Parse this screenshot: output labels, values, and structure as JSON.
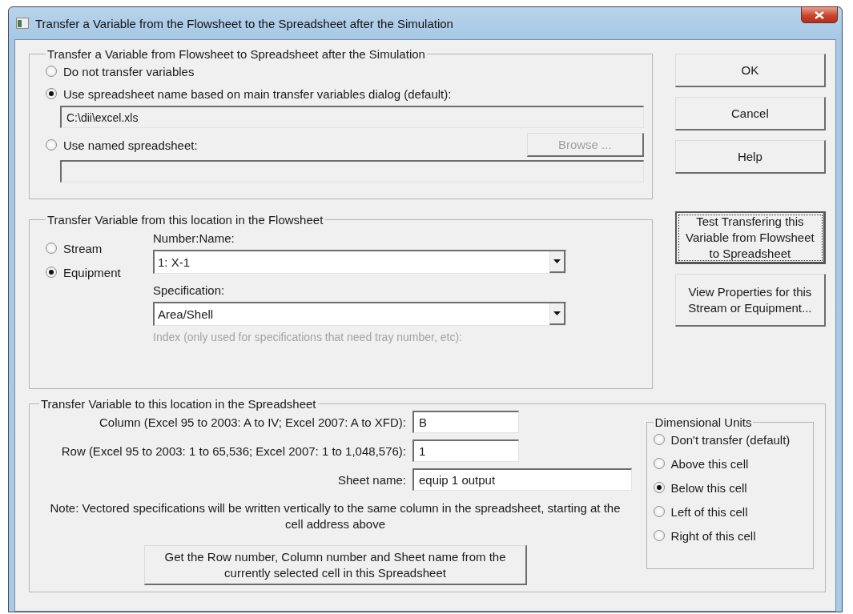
{
  "window": {
    "title": "Transfer a Variable from the Flowsheet to the Spreadsheet after the Simulation"
  },
  "transfer_group": {
    "title": "Transfer a Variable from Flowsheet to Spreadsheet after the Simulation",
    "options": [
      {
        "label": "Do not transfer variables",
        "selected": false
      },
      {
        "label": "Use spreadsheet name based on main transfer variables dialog (default):",
        "selected": true,
        "field": {
          "value": "C:\\dii\\excel.xls",
          "disabled": true
        }
      },
      {
        "label": "Use named spreadsheet:",
        "selected": false,
        "field": {
          "disabled": true
        }
      }
    ],
    "browse_button": {
      "label": "Browse ...",
      "disabled": true
    }
  },
  "source_group": {
    "title": "Transfer Variable from this location in the Flowsheet",
    "types": [
      {
        "label": "Stream",
        "selected": false
      },
      {
        "label": "Equipment",
        "selected": true
      }
    ],
    "number_name": {
      "label": "Number:Name:",
      "value": "1: X-1"
    },
    "specification": {
      "label": "Specification:",
      "value": "Area/Shell"
    },
    "index": {
      "label": "Index (only used for specifications that need tray number, etc):",
      "disabled": true
    }
  },
  "buttons": [
    {
      "label": "OK",
      "focused": false
    },
    {
      "label": "Cancel",
      "focused": false
    },
    {
      "label": "Help",
      "focused": false
    },
    {
      "label": "Test Transfering this Variable from Flowsheet to Spreadsheet",
      "focused": true
    },
    {
      "label": "View Properties for this Stream or Equipment...",
      "focused": false
    }
  ],
  "destination_group": {
    "title": "Transfer Variable to this location in the Spreadsheet",
    "fields": [
      {
        "label": "Column (Excel 95 to 2003: A to IV; Excel 2007: A to XFD):",
        "value": "B"
      },
      {
        "label": "Row (Excel 95 to 2003: 1 to 65,536; Excel 2007: 1 to 1,048,576):",
        "value": "1"
      },
      {
        "label": "Sheet name:",
        "value": "equip 1 output"
      }
    ],
    "note": "Note: Vectored specifications will be written vertically to the same column in the spreadsheet, starting at the cell address above",
    "get_button": {
      "label": "Get the Row number, Column number and Sheet name from the currently selected cell in this Spreadsheet"
    },
    "units": {
      "title": "Dimensional Units",
      "options": [
        {
          "label": "Don't transfer (default)",
          "selected": false
        },
        {
          "label": "Above this cell",
          "selected": false
        },
        {
          "label": "Below this cell",
          "selected": true
        },
        {
          "label": "Left of this cell",
          "selected": false
        },
        {
          "label": "Right of this cell",
          "selected": false
        }
      ]
    }
  }
}
